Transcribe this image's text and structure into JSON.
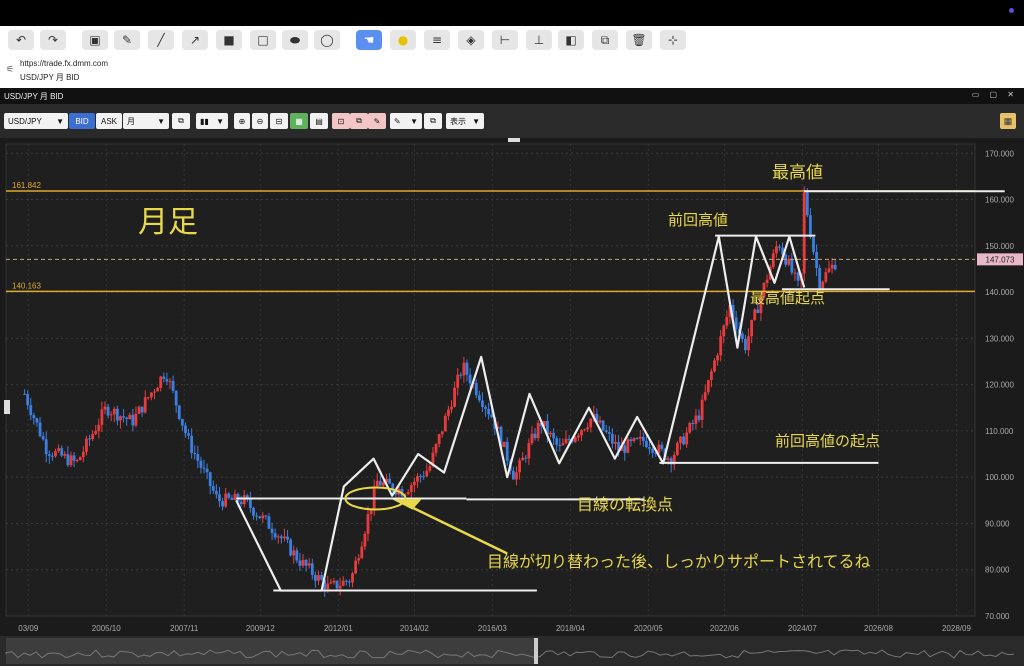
{
  "browser_url": "https://trade.fx.dmm.com",
  "tab_title": "USD/JPY 月 BID",
  "window_title": "USD/JPY 月 BID",
  "controls": {
    "symbol": "USD/JPY",
    "bid": "BID",
    "ask": "ASK",
    "period": "月",
    "display": "表示"
  },
  "window_controls": "▭ ▢ ✕",
  "chart_data": {
    "type": "candlestick",
    "ylim": [
      70,
      172
    ],
    "y_ticks": [
      "70.000",
      "80.000",
      "90.000",
      "100.000",
      "110.000",
      "120.000",
      "130.000",
      "140.000",
      "150.000",
      "160.000",
      "170.000"
    ],
    "x_ticks": [
      "03/09",
      "2005/10",
      "2007/11",
      "2009/12",
      "2012/01",
      "2014/02",
      "2016/03",
      "2018/04",
      "2020/05",
      "2022/06",
      "2024/07",
      "2026/08",
      "2028/09"
    ],
    "current_price": "147.073",
    "levels": [
      {
        "label": "161.842",
        "value": 161.842
      },
      {
        "label": "140.163",
        "value": 140.163
      }
    ],
    "annotations": {
      "monthly": "月足",
      "all_time_high": "最高値",
      "prev_high": "前回高値",
      "ath_origin": "最高値起点",
      "prev_high_origin": "前回高値の起点",
      "turning_point": "目線の転換点",
      "support_note": "目線が切り替わった後、しっかりサポートされてるね"
    },
    "price_path": [
      [
        2003.6,
        118
      ],
      [
        2004.2,
        106
      ],
      [
        2005.0,
        103
      ],
      [
        2005.8,
        115
      ],
      [
        2006.5,
        112
      ],
      [
        2007.4,
        123
      ],
      [
        2008.0,
        108
      ],
      [
        2008.8,
        95
      ],
      [
        2009.5,
        95
      ],
      [
        2010.4,
        88
      ],
      [
        2011.0,
        82
      ],
      [
        2011.8,
        76
      ],
      [
        2012.4,
        78
      ],
      [
        2013.1,
        99
      ],
      [
        2013.8,
        97
      ],
      [
        2014.5,
        102
      ],
      [
        2015.4,
        124
      ],
      [
        2016.2,
        113
      ],
      [
        2016.8,
        100
      ],
      [
        2017.5,
        112
      ],
      [
        2018.0,
        106
      ],
      [
        2018.9,
        113
      ],
      [
        2019.6,
        106
      ],
      [
        2020.3,
        108
      ],
      [
        2021.0,
        104
      ],
      [
        2021.8,
        114
      ],
      [
        2022.6,
        137
      ],
      [
        2023.0,
        128
      ],
      [
        2023.9,
        151
      ],
      [
        2024.5,
        140
      ],
      [
        2024.6,
        161
      ],
      [
        2025.0,
        142
      ],
      [
        2025.5,
        147
      ]
    ],
    "pattern_lines": [
      [
        [
          2009.3,
          95
        ],
        [
          2010.5,
          75.5
        ],
        [
          2011.6,
          75.5
        ],
        [
          2012.2,
          98
        ],
        [
          2013.0,
          104
        ],
        [
          2013.5,
          96
        ],
        [
          2014.2,
          105
        ],
        [
          2014.9,
          101
        ],
        [
          2015.9,
          126
        ],
        [
          2016.6,
          100
        ],
        [
          2017.2,
          118
        ],
        [
          2018.0,
          103
        ],
        [
          2018.8,
          115
        ],
        [
          2019.5,
          104
        ],
        [
          2020.1,
          113
        ],
        [
          2020.8,
          103
        ],
        [
          2022.3,
          152
        ],
        [
          2022.8,
          128
        ],
        [
          2023.3,
          152
        ],
        [
          2023.8,
          142
        ],
        [
          2024.2,
          152
        ],
        [
          2024.6,
          141
        ]
      ]
    ]
  }
}
